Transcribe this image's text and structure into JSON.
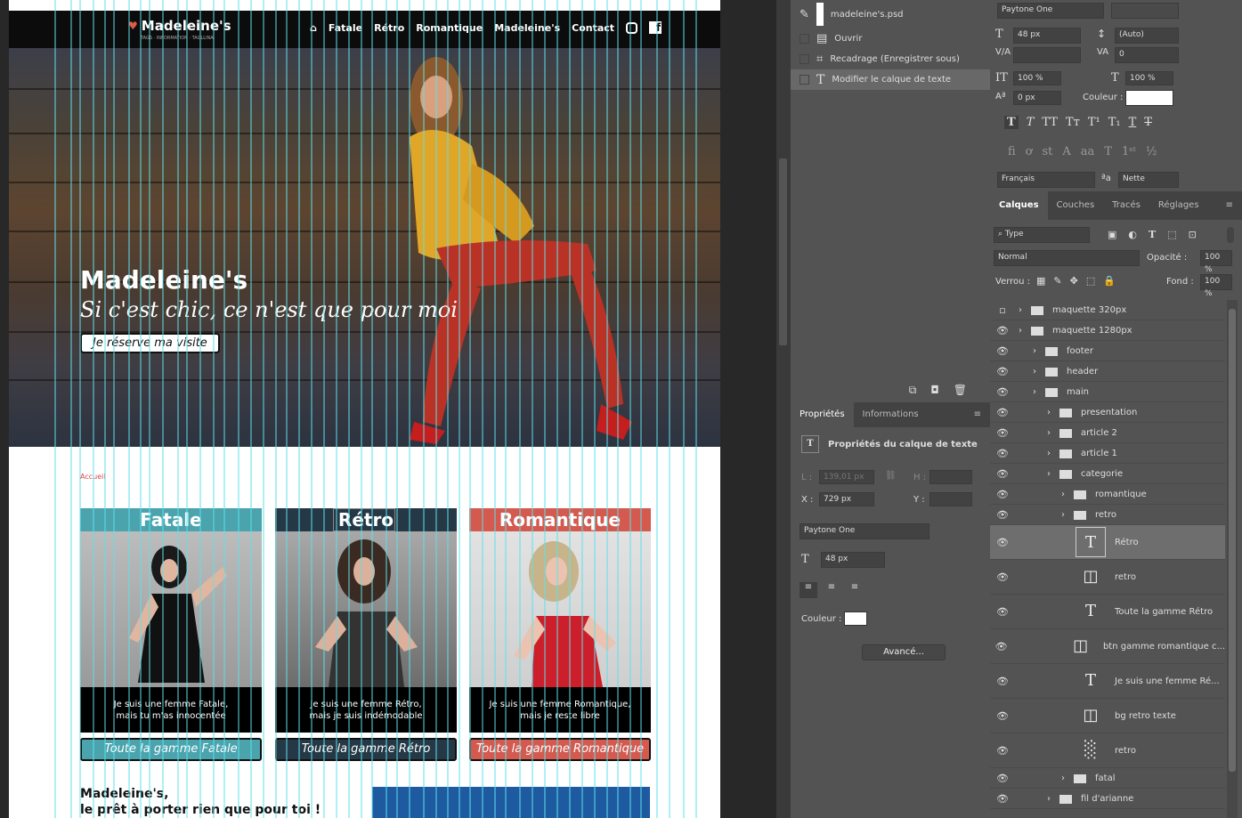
{
  "document": {
    "nav": {
      "brand": "Madeleine's",
      "tagline": "TAGS  ·  INFORMATION  ·  TAGLLINA",
      "links": [
        "Fatale",
        "Rétro",
        "Romantique",
        "Madeleine's",
        "Contact"
      ]
    },
    "hero": {
      "title": "Madeleine's",
      "subtitle": "Si c'est chic, ce n'est que pour moi",
      "button": "Je réserve ma visite"
    },
    "breadcrumb": "Accueil",
    "cards": [
      {
        "title": "Fatale",
        "line1": "Je suis une femme Fatale,",
        "line2": "mais tu m'as innocentée",
        "button": "Toute la gamme Fatale",
        "color": "#4aa3ad"
      },
      {
        "title": "Rétro",
        "line1": "Je suis une femme Rétro,",
        "line2": "mais je suis indémodable",
        "button": "Toute la gamme Rétro",
        "color": "#253845"
      },
      {
        "title": "Romantique",
        "line1": "Je suis une femme Romantique,",
        "line2": "mais je reste libre",
        "button": "Toute la gamme Romantique",
        "color": "#d45a4f"
      }
    ],
    "bottom": {
      "line1": "Madeleine's,",
      "line2": "le prêt à porter rien que pour toi !"
    }
  },
  "history": {
    "file": "madeleine's.psd",
    "steps": [
      "Ouvrir",
      "Recadrage (Enregistrer sous)",
      "Modifier le calque de texte"
    ]
  },
  "properties": {
    "tabs": [
      "Propriétés",
      "Informations"
    ],
    "heading": "Propriétés du calque de texte",
    "w_label": "L :",
    "w_value": "139,01 px",
    "h_label": "H :",
    "x_label": "X :",
    "x_value": "729 px",
    "y_label": "Y :",
    "font": "Paytone One",
    "size": "48 px",
    "color_label": "Couleur :",
    "advanced": "Avancé..."
  },
  "character": {
    "font": "Paytone One",
    "size": "48 px",
    "leading": "(Auto)",
    "tracking": "0",
    "vscale": "100 %",
    "hscale": "100 %",
    "baseline": "0 px",
    "color_label": "Couleur :",
    "language": "Français",
    "antialias": "Nette",
    "aa_label": "ªa"
  },
  "layers": {
    "tabs": [
      "Calques",
      "Couches",
      "Tracés",
      "Réglages"
    ],
    "filter": "Type",
    "blend": "Normal",
    "opacity_label": "Opacité :",
    "opacity": "100 %",
    "lock_label": "Verrou :",
    "fill_label": "Fond :",
    "fill": "100 %",
    "items": [
      {
        "name": "maquette 320px",
        "type": "folder",
        "level": 0,
        "visible": false
      },
      {
        "name": "maquette 1280px",
        "type": "folder",
        "level": 0,
        "visible": true
      },
      {
        "name": "footer",
        "type": "folder",
        "level": 1,
        "visible": true
      },
      {
        "name": "header",
        "type": "folder",
        "level": 1,
        "visible": true
      },
      {
        "name": "main",
        "type": "folder",
        "level": 1,
        "visible": true
      },
      {
        "name": "presentation",
        "type": "folder",
        "level": 2,
        "visible": true
      },
      {
        "name": "article 2",
        "type": "folder",
        "level": 2,
        "visible": true
      },
      {
        "name": "article 1",
        "type": "folder",
        "level": 2,
        "visible": true
      },
      {
        "name": "categorie",
        "type": "folder",
        "level": 2,
        "visible": true
      },
      {
        "name": "romantique",
        "type": "folder",
        "level": 3,
        "visible": true
      },
      {
        "name": "retro",
        "type": "folder",
        "level": 3,
        "visible": true
      },
      {
        "name": "Rétro",
        "type": "text",
        "level": 4,
        "visible": true,
        "selected": true
      },
      {
        "name": "retro",
        "type": "shape",
        "level": 4,
        "visible": true
      },
      {
        "name": "Toute la gamme Rétro",
        "type": "text",
        "level": 4,
        "visible": true
      },
      {
        "name": "btn gamme romantique c...",
        "type": "shape",
        "level": 4,
        "visible": true
      },
      {
        "name": "Je suis une femme Ré...",
        "type": "text",
        "level": 4,
        "visible": true
      },
      {
        "name": "bg retro texte",
        "type": "shape",
        "level": 4,
        "visible": true
      },
      {
        "name": "retro",
        "type": "image",
        "level": 4,
        "visible": true
      },
      {
        "name": "fatal",
        "type": "folder",
        "level": 3,
        "visible": true
      },
      {
        "name": "fil d'arianne",
        "type": "folder",
        "level": 2,
        "visible": true
      }
    ]
  }
}
